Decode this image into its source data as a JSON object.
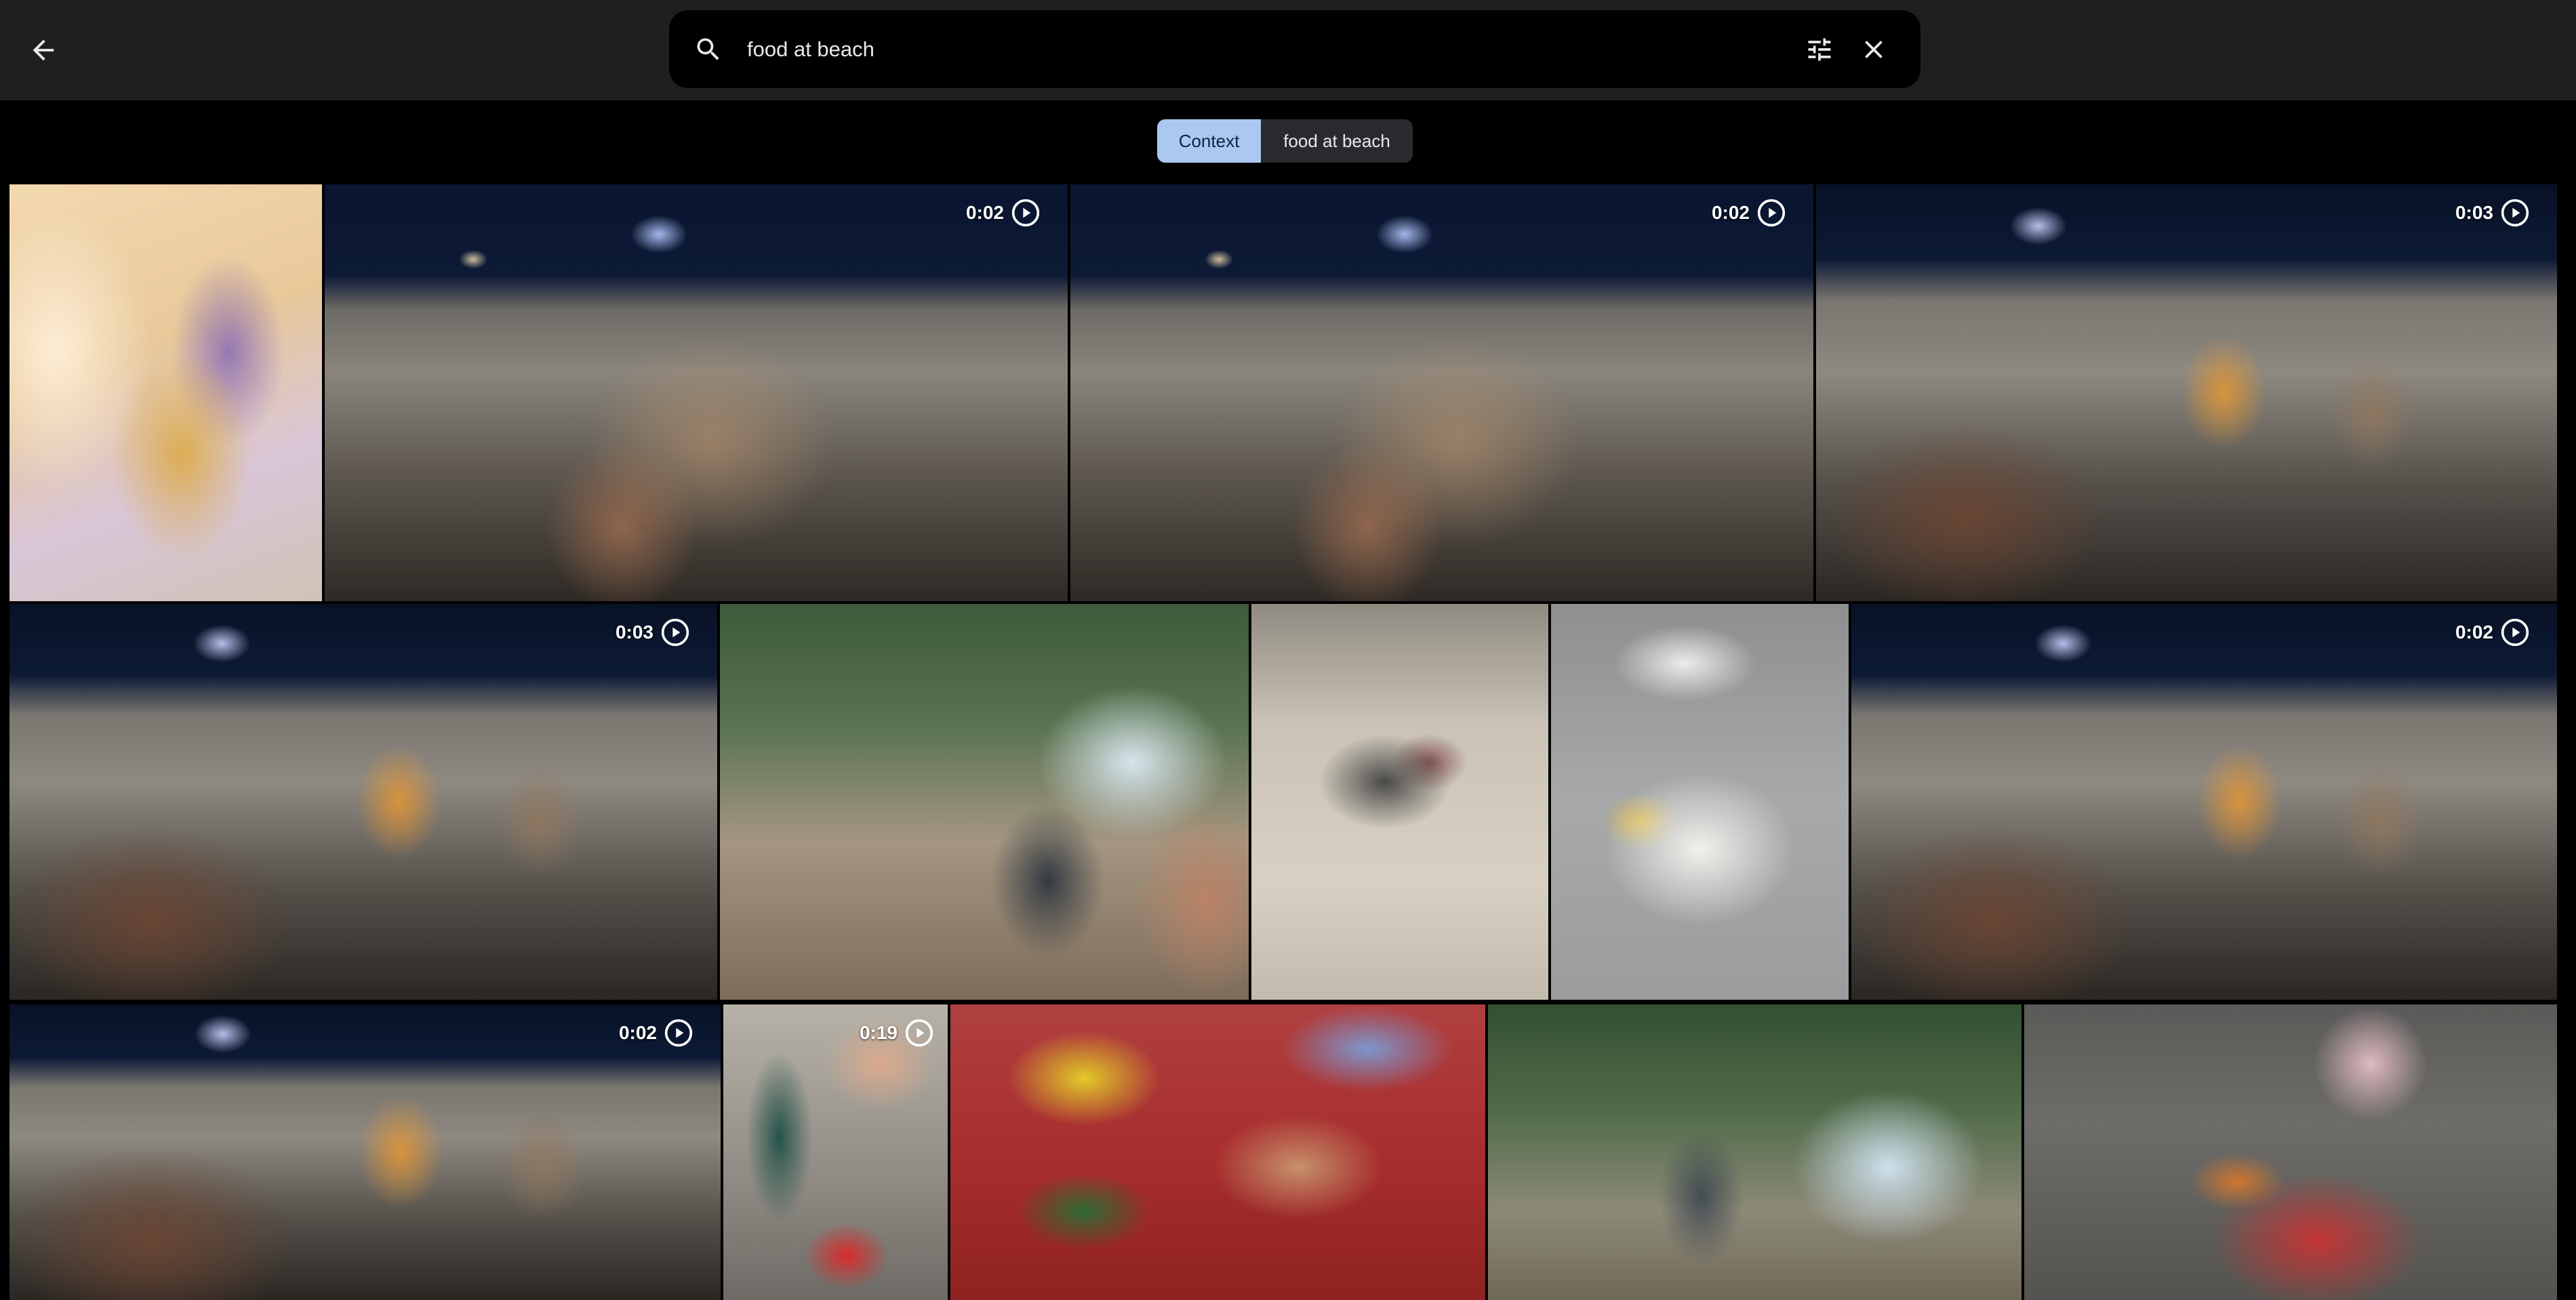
{
  "search": {
    "query": "food at beach",
    "back_icon": "arrow-left-icon",
    "search_icon": "magnifier-icon",
    "filter_icon": "sliders-icon",
    "clear_icon": "close-icon"
  },
  "chips": [
    {
      "label": "Context",
      "active": true
    },
    {
      "label": "food at beach",
      "active": false
    }
  ],
  "colors": {
    "topbar": "#1f1f1f",
    "page_background": "#000000",
    "active_chip": "#aac8f0",
    "inactive_chip": "#2a2a2e"
  },
  "results": [
    {
      "id": "r1",
      "type": "photo"
    },
    {
      "id": "r2",
      "type": "video",
      "duration": "0:02"
    },
    {
      "id": "r3",
      "type": "video",
      "duration": "0:02"
    },
    {
      "id": "r4",
      "type": "video",
      "duration": "0:03"
    },
    {
      "id": "r5",
      "type": "video",
      "duration": "0:03"
    },
    {
      "id": "r6",
      "type": "photo"
    },
    {
      "id": "r7",
      "type": "photo"
    },
    {
      "id": "r8",
      "type": "photo"
    },
    {
      "id": "r9",
      "type": "video",
      "duration": "0:02"
    },
    {
      "id": "r10",
      "type": "video",
      "duration": "0:02"
    },
    {
      "id": "r11",
      "type": "video",
      "duration": "0:19"
    },
    {
      "id": "r12",
      "type": "photo"
    },
    {
      "id": "r13",
      "type": "photo"
    },
    {
      "id": "r14",
      "type": "photo"
    }
  ]
}
